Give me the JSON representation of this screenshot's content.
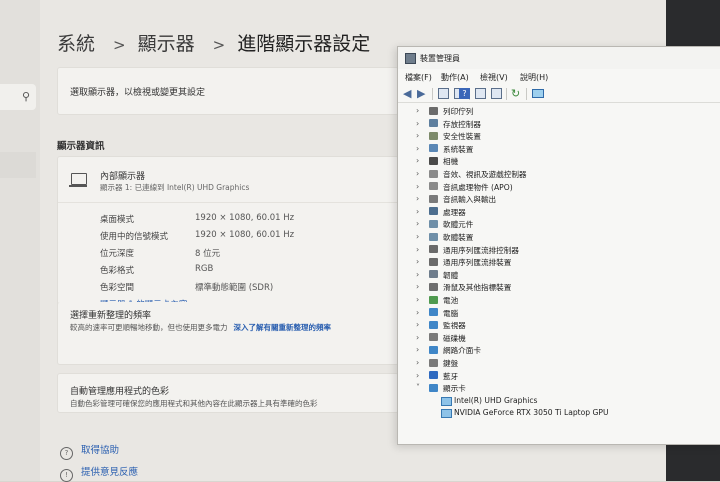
{
  "settings": {
    "breadcrumb": [
      "系統",
      "顯示器",
      "進階顯示器設定"
    ],
    "select_display_text": "選取顯示器，以檢視或變更其設定",
    "section_title": "顯示器資訊",
    "display": {
      "name": "內部顯示器",
      "subtitle": "顯示器 1: 已連線到 Intel(R) UHD Graphics",
      "rows": [
        {
          "key": "桌面模式",
          "value": "1920 × 1080, 60.01 Hz"
        },
        {
          "key": "使用中的信號模式",
          "value": "1920 × 1080, 60.01 Hz"
        },
        {
          "key": "位元深度",
          "value": "8 位元"
        },
        {
          "key": "色彩格式",
          "value": "RGB"
        },
        {
          "key": "色彩空間",
          "value": "標準動態範圍 (SDR)"
        }
      ],
      "adapter_link": "顯示器 1 的顯示卡內容"
    },
    "refresh": {
      "title": "選擇重新整理的頻率",
      "desc": "較高的速率可更順暢地移動，但也使用更多電力",
      "link": "深入了解有關重新整理的頻率"
    },
    "color": {
      "title": "自動管理應用程式的色彩",
      "desc": "自動色彩管理可確保您的應用程式和其他內容在此顯示器上具有準確的色彩"
    },
    "help_links": [
      "取得協助",
      "提供意見反應"
    ]
  },
  "device_manager": {
    "title": "裝置管理員",
    "menu": [
      "檔案(F)",
      "動作(A)",
      "檢視(V)",
      "說明(H)"
    ],
    "categories": [
      {
        "label": "列印佇列",
        "icon": "printer-icon",
        "color": "#6b6b6b"
      },
      {
        "label": "存放控制器",
        "icon": "storage-controller-icon",
        "color": "#5e7f9e"
      },
      {
        "label": "安全性裝置",
        "icon": "security-device-icon",
        "color": "#7d8a6a"
      },
      {
        "label": "系統裝置",
        "icon": "system-device-icon",
        "color": "#5a87b5"
      },
      {
        "label": "相機",
        "icon": "camera-icon",
        "color": "#4a4a4a"
      },
      {
        "label": "音效、視訊及遊戲控制器",
        "icon": "audio-icon",
        "color": "#8a8a8a"
      },
      {
        "label": "音訊處理物件 (APO)",
        "icon": "apo-icon",
        "color": "#8a8a8a"
      },
      {
        "label": "音訊輸入與輸出",
        "icon": "speaker-icon",
        "color": "#7a7a7a"
      },
      {
        "label": "處理器",
        "icon": "processor-icon",
        "color": "#4d6e8f"
      },
      {
        "label": "軟體元件",
        "icon": "software-component-icon",
        "color": "#6f8fa8"
      },
      {
        "label": "軟體裝置",
        "icon": "software-device-icon",
        "color": "#6f8fa8"
      },
      {
        "label": "通用序列匯流排控制器",
        "icon": "usb-controller-icon",
        "color": "#6a6a6a"
      },
      {
        "label": "通用序列匯流排裝置",
        "icon": "usb-device-icon",
        "color": "#6a6a6a"
      },
      {
        "label": "韌體",
        "icon": "firmware-icon",
        "color": "#6e7d8c"
      },
      {
        "label": "滑鼠及其他指標裝置",
        "icon": "mouse-icon",
        "color": "#6e6e6e"
      },
      {
        "label": "電池",
        "icon": "battery-icon",
        "color": "#4f9a4f"
      },
      {
        "label": "電腦",
        "icon": "computer-icon",
        "color": "#3f86c7"
      },
      {
        "label": "監視器",
        "icon": "monitor-icon",
        "color": "#3f86c7"
      },
      {
        "label": "磁碟機",
        "icon": "disk-drive-icon",
        "color": "#7a7a7a"
      },
      {
        "label": "網路介面卡",
        "icon": "network-adapter-icon",
        "color": "#3f86c7"
      },
      {
        "label": "鍵盤",
        "icon": "keyboard-icon",
        "color": "#7a7a7a"
      },
      {
        "label": "藍牙",
        "icon": "bluetooth-icon",
        "color": "#2f6ac0"
      },
      {
        "label": "顯示卡",
        "icon": "display-adapter-icon",
        "color": "#3f86c7",
        "expanded": true
      }
    ],
    "display_adapters": [
      "Intel(R) UHD Graphics",
      "NVIDIA GeForce RTX 3050 Ti Laptop GPU"
    ]
  }
}
